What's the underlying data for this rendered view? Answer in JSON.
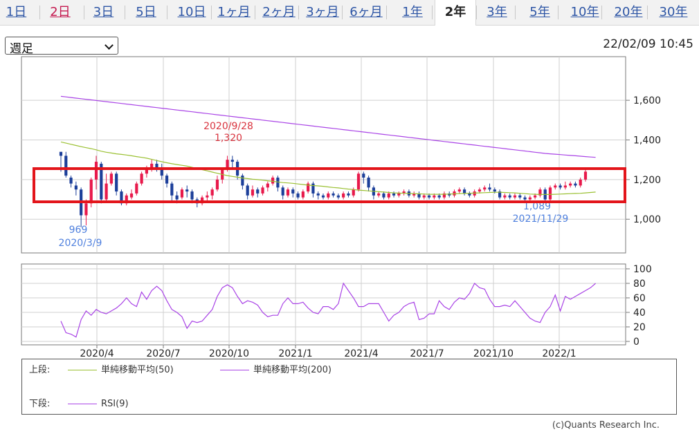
{
  "tabs": [
    {
      "label": "1日"
    },
    {
      "label": "2日"
    },
    {
      "label": "3日"
    },
    {
      "label": "5日"
    },
    {
      "label": "10日"
    },
    {
      "label": "1ヶ月"
    },
    {
      "label": "2ヶ月"
    },
    {
      "label": "3ヶ月"
    },
    {
      "label": "6ヶ月"
    },
    {
      "label": "1年"
    },
    {
      "label": "2年"
    },
    {
      "label": "3年"
    },
    {
      "label": "5年"
    },
    {
      "label": "10年"
    },
    {
      "label": "20年"
    },
    {
      "label": "30年"
    }
  ],
  "active_tab": "2年",
  "highlight_tab": "2日",
  "period_select": {
    "value": "週足"
  },
  "timestamp": "22/02/09 10:45",
  "legend": {
    "upper_label": "上段:",
    "lower_label": "下段:",
    "sma50": "単純移動平均(50)",
    "sma200": "単純移動平均(200)",
    "rsi": "RSI(9)"
  },
  "copyright": "(c)Quants Research Inc.",
  "colors": {
    "up": "#e8194b",
    "down": "#1c3f9a",
    "sma50": "#9ac031",
    "sma200": "#a943e6",
    "rsi": "#a943e6",
    "box": "#e3151b",
    "annotation_high": "#d9343f",
    "annotation_low": "#4f80de"
  },
  "chart_data": [
    {
      "type": "candlestick",
      "x_ticks": [
        "2020/4",
        "2020/7",
        "2020/10",
        "2021/1",
        "2021/4",
        "2021/7",
        "2021/10",
        "2022/1"
      ],
      "y_ticks": [
        "1,000",
        "1,200",
        "1,400",
        "1,600"
      ],
      "ylim": [
        830,
        1820
      ],
      "candles": [
        [
          1340,
          1320,
          1330,
          1240
        ],
        [
          1320,
          1220,
          1340,
          1210
        ],
        [
          1210,
          1180,
          1220,
          1160
        ],
        [
          1170,
          1150,
          1190,
          1120
        ],
        [
          1150,
          1020,
          1160,
          960
        ],
        [
          1020,
          1080,
          1100,
          969
        ],
        [
          1080,
          1200,
          1210,
          1060
        ],
        [
          1200,
          1290,
          1320,
          1150
        ],
        [
          1280,
          1100,
          1290,
          1080
        ],
        [
          1100,
          1180,
          1230,
          1090
        ],
        [
          1180,
          1230,
          1240,
          1170
        ],
        [
          1230,
          1140,
          1240,
          1120
        ],
        [
          1140,
          1080,
          1150,
          1070
        ],
        [
          1080,
          1120,
          1130,
          1070
        ],
        [
          1110,
          1130,
          1150,
          1100
        ],
        [
          1130,
          1180,
          1190,
          1120
        ],
        [
          1180,
          1230,
          1240,
          1170
        ],
        [
          1230,
          1260,
          1270,
          1210
        ],
        [
          1260,
          1280,
          1300,
          1240
        ],
        [
          1280,
          1260,
          1300,
          1240
        ],
        [
          1260,
          1220,
          1280,
          1200
        ],
        [
          1220,
          1180,
          1230,
          1160
        ],
        [
          1180,
          1120,
          1190,
          1090
        ],
        [
          1120,
          1100,
          1140,
          1080
        ],
        [
          1110,
          1150,
          1160,
          1100
        ],
        [
          1150,
          1140,
          1170,
          1110
        ],
        [
          1140,
          1100,
          1150,
          1080
        ],
        [
          1100,
          1080,
          1110,
          1060
        ],
        [
          1080,
          1110,
          1120,
          1070
        ],
        [
          1110,
          1120,
          1140,
          1090
        ],
        [
          1120,
          1150,
          1160,
          1100
        ],
        [
          1150,
          1200,
          1220,
          1140
        ],
        [
          1200,
          1250,
          1260,
          1180
        ],
        [
          1250,
          1300,
          1320,
          1240
        ],
        [
          1300,
          1290,
          1320,
          1260
        ],
        [
          1290,
          1220,
          1300,
          1200
        ],
        [
          1220,
          1170,
          1230,
          1150
        ],
        [
          1170,
          1120,
          1180,
          1100
        ],
        [
          1120,
          1150,
          1170,
          1110
        ],
        [
          1150,
          1130,
          1160,
          1110
        ],
        [
          1130,
          1160,
          1170,
          1120
        ],
        [
          1160,
          1180,
          1190,
          1140
        ],
        [
          1180,
          1210,
          1220,
          1170
        ],
        [
          1210,
          1160,
          1220,
          1140
        ],
        [
          1160,
          1120,
          1170,
          1100
        ],
        [
          1120,
          1150,
          1160,
          1110
        ],
        [
          1150,
          1130,
          1160,
          1110
        ],
        [
          1130,
          1110,
          1140,
          1100
        ],
        [
          1110,
          1140,
          1150,
          1100
        ],
        [
          1140,
          1180,
          1190,
          1130
        ],
        [
          1180,
          1130,
          1190,
          1110
        ],
        [
          1130,
          1120,
          1140,
          1100
        ],
        [
          1120,
          1110,
          1130,
          1100
        ],
        [
          1110,
          1130,
          1140,
          1100
        ],
        [
          1130,
          1120,
          1140,
          1110
        ],
        [
          1120,
          1110,
          1130,
          1100
        ],
        [
          1110,
          1130,
          1140,
          1100
        ],
        [
          1130,
          1120,
          1140,
          1110
        ],
        [
          1120,
          1150,
          1160,
          1110
        ],
        [
          1150,
          1230,
          1240,
          1140
        ],
        [
          1230,
          1210,
          1240,
          1180
        ],
        [
          1210,
          1160,
          1220,
          1140
        ],
        [
          1160,
          1120,
          1170,
          1100
        ],
        [
          1120,
          1130,
          1140,
          1110
        ],
        [
          1130,
          1110,
          1140,
          1100
        ],
        [
          1110,
          1130,
          1140,
          1100
        ],
        [
          1130,
          1120,
          1140,
          1110
        ],
        [
          1120,
          1130,
          1140,
          1110
        ],
        [
          1130,
          1140,
          1150,
          1120
        ],
        [
          1140,
          1120,
          1150,
          1110
        ],
        [
          1120,
          1130,
          1140,
          1110
        ],
        [
          1130,
          1110,
          1140,
          1100
        ],
        [
          1110,
          1120,
          1130,
          1100
        ],
        [
          1120,
          1110,
          1130,
          1100
        ],
        [
          1110,
          1120,
          1130,
          1100
        ],
        [
          1120,
          1110,
          1130,
          1100
        ],
        [
          1110,
          1130,
          1140,
          1100
        ],
        [
          1130,
          1120,
          1140,
          1110
        ],
        [
          1120,
          1140,
          1150,
          1110
        ],
        [
          1140,
          1150,
          1160,
          1130
        ],
        [
          1150,
          1130,
          1160,
          1120
        ],
        [
          1130,
          1120,
          1140,
          1110
        ],
        [
          1120,
          1140,
          1150,
          1110
        ],
        [
          1140,
          1150,
          1160,
          1130
        ],
        [
          1150,
          1160,
          1170,
          1140
        ],
        [
          1160,
          1150,
          1180,
          1140
        ],
        [
          1150,
          1140,
          1160,
          1130
        ],
        [
          1140,
          1110,
          1150,
          1100
        ],
        [
          1110,
          1120,
          1130,
          1100
        ],
        [
          1120,
          1110,
          1130,
          1100
        ],
        [
          1110,
          1120,
          1130,
          1100
        ],
        [
          1120,
          1110,
          1130,
          1100
        ],
        [
          1110,
          1100,
          1120,
          1090
        ],
        [
          1100,
          1110,
          1120,
          1089
        ],
        [
          1110,
          1120,
          1130,
          1100
        ],
        [
          1120,
          1150,
          1160,
          1110
        ],
        [
          1150,
          1100,
          1160,
          1090
        ],
        [
          1100,
          1160,
          1170,
          1090
        ],
        [
          1160,
          1170,
          1180,
          1150
        ],
        [
          1170,
          1160,
          1180,
          1150
        ],
        [
          1160,
          1170,
          1190,
          1150
        ],
        [
          1170,
          1180,
          1190,
          1160
        ],
        [
          1180,
          1170,
          1190,
          1160
        ],
        [
          1170,
          1200,
          1210,
          1160
        ],
        [
          1200,
          1240,
          1250,
          1190
        ]
      ],
      "sma50": [
        1390,
        1384,
        1378,
        1372,
        1366,
        1361,
        1356,
        1350,
        1343,
        1338,
        1334,
        1330,
        1327,
        1324,
        1320,
        1316,
        1312,
        1308,
        1302,
        1296,
        1290,
        1285,
        1280,
        1276,
        1272,
        1268,
        1262,
        1256,
        1250,
        1244,
        1238,
        1232,
        1226,
        1220,
        1216,
        1212,
        1208,
        1205,
        1202,
        1200,
        1197,
        1194,
        1191,
        1188,
        1185,
        1183,
        1181,
        1178,
        1175,
        1172,
        1170,
        1168,
        1166,
        1163,
        1160,
        1158,
        1155,
        1152,
        1150,
        1147,
        1145,
        1143,
        1141,
        1139,
        1137,
        1135,
        1133,
        1132,
        1131,
        1130,
        1129,
        1128,
        1127,
        1126,
        1126,
        1126,
        1126,
        1127,
        1128,
        1129,
        1130,
        1131,
        1132,
        1133,
        1134,
        1135,
        1136,
        1136,
        1135,
        1134,
        1133,
        1131,
        1129,
        1127,
        1126,
        1125,
        1125,
        1125,
        1126,
        1127,
        1128,
        1129,
        1130,
        1131,
        1133,
        1135,
        1137
      ],
      "sma200": [
        1620,
        1617,
        1614,
        1611,
        1608,
        1605,
        1602,
        1599,
        1596,
        1593,
        1590,
        1587,
        1584,
        1581,
        1578,
        1575,
        1572,
        1569,
        1566,
        1563,
        1560,
        1557,
        1554,
        1551,
        1548,
        1545,
        1542,
        1539,
        1536,
        1533,
        1530,
        1527,
        1524,
        1521,
        1518,
        1515,
        1512,
        1509,
        1506,
        1503,
        1500,
        1497,
        1494,
        1491,
        1488,
        1485,
        1482,
        1479,
        1476,
        1473,
        1470,
        1467,
        1464,
        1461,
        1458,
        1455,
        1452,
        1449,
        1446,
        1443,
        1440,
        1437,
        1434,
        1431,
        1428,
        1425,
        1422,
        1419,
        1416,
        1413,
        1410,
        1407,
        1404,
        1401,
        1398,
        1395,
        1392,
        1389,
        1386,
        1383,
        1380,
        1377,
        1374,
        1371,
        1368,
        1365,
        1362,
        1359,
        1356,
        1353,
        1350,
        1347,
        1344,
        1341,
        1338,
        1335,
        1332,
        1330,
        1328,
        1326,
        1324,
        1322,
        1320,
        1318,
        1316,
        1314,
        1312
      ],
      "annotations": [
        {
          "label": "2020/9/28",
          "value": "1,320",
          "kind": "high"
        },
        {
          "label": "969",
          "value": "2020/3/9",
          "kind": "low"
        },
        {
          "label": "1,089",
          "value": "2021/11/29",
          "kind": "low"
        }
      ]
    },
    {
      "type": "line",
      "name": "RSI(9)",
      "y_ticks": [
        "0",
        "20",
        "40",
        "60",
        "80",
        "100"
      ],
      "ylim": [
        0,
        100
      ],
      "values": [
        28,
        12,
        10,
        6,
        30,
        42,
        36,
        44,
        40,
        38,
        42,
        46,
        52,
        60,
        52,
        48,
        68,
        58,
        70,
        76,
        70,
        56,
        44,
        40,
        34,
        18,
        28,
        26,
        28,
        36,
        44,
        62,
        74,
        78,
        74,
        62,
        52,
        56,
        54,
        50,
        40,
        34,
        36,
        36,
        52,
        60,
        52,
        52,
        54,
        46,
        40,
        38,
        48,
        48,
        44,
        52,
        80,
        70,
        60,
        48,
        48,
        52,
        52,
        52,
        40,
        28,
        36,
        40,
        48,
        52,
        54,
        30,
        32,
        38,
        38,
        56,
        48,
        44,
        54,
        60,
        58,
        66,
        80,
        74,
        72,
        58,
        48,
        48,
        50,
        48,
        56,
        48,
        40,
        32,
        28,
        26,
        40,
        48,
        64,
        42,
        62,
        58,
        62,
        66,
        70,
        74,
        80
      ]
    }
  ]
}
